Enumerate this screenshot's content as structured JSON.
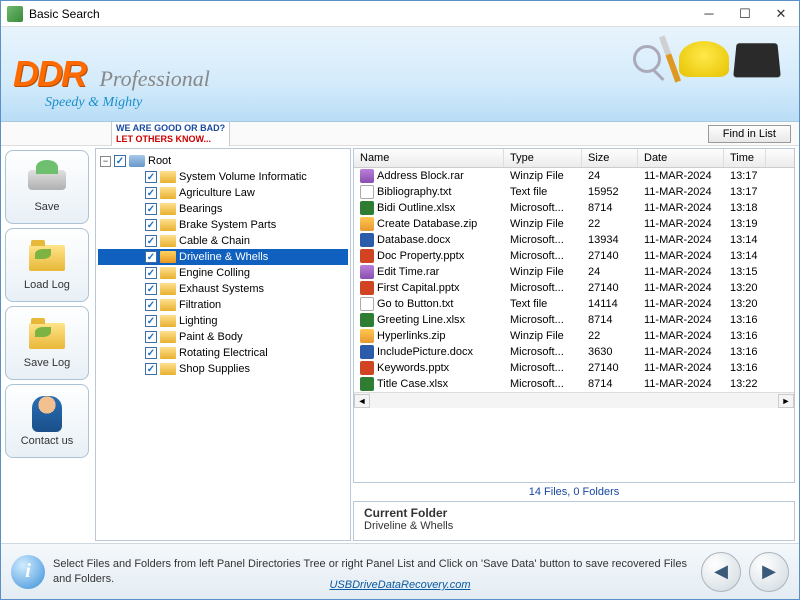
{
  "window": {
    "title": "Basic Search"
  },
  "banner": {
    "brand": "DDR",
    "product": "Professional",
    "tagline": "Speedy & Mighty"
  },
  "toolbar": {
    "good_bad_line1": "WE ARE GOOD OR BAD?",
    "good_bad_line2": "LET OTHERS KNOW...",
    "find_in_list": "Find in List"
  },
  "rail": {
    "save": "Save",
    "load_log": "Load Log",
    "save_log": "Save Log",
    "contact": "Contact us"
  },
  "tree": {
    "root": "Root",
    "items": [
      "System Volume Informatic",
      "Agriculture Law",
      "Bearings",
      "Brake System Parts",
      "Cable & Chain",
      "Driveline & Whells",
      "Engine Colling",
      "Exhaust Systems",
      "Filtration",
      "Lighting",
      "Paint & Body",
      "Rotating Electrical",
      "Shop Supplies"
    ],
    "selected_index": 5
  },
  "list": {
    "headers": {
      "name": "Name",
      "type": "Type",
      "size": "Size",
      "date": "Date",
      "time": "Time"
    },
    "rows": [
      {
        "icon": "rar",
        "name": "Address Block.rar",
        "type": "Winzip File",
        "size": "24",
        "date": "11-MAR-2024",
        "time": "13:17"
      },
      {
        "icon": "txt",
        "name": "Bibliography.txt",
        "type": "Text file",
        "size": "15952",
        "date": "11-MAR-2024",
        "time": "13:17"
      },
      {
        "icon": "xlsx",
        "name": "Bidi Outline.xlsx",
        "type": "Microsoft...",
        "size": "8714",
        "date": "11-MAR-2024",
        "time": "13:18"
      },
      {
        "icon": "zip",
        "name": "Create Database.zip",
        "type": "Winzip File",
        "size": "22",
        "date": "11-MAR-2024",
        "time": "13:19"
      },
      {
        "icon": "docx",
        "name": "Database.docx",
        "type": "Microsoft...",
        "size": "13934",
        "date": "11-MAR-2024",
        "time": "13:14"
      },
      {
        "icon": "pptx",
        "name": "Doc Property.pptx",
        "type": "Microsoft...",
        "size": "27140",
        "date": "11-MAR-2024",
        "time": "13:14"
      },
      {
        "icon": "rar",
        "name": "Edit Time.rar",
        "type": "Winzip File",
        "size": "24",
        "date": "11-MAR-2024",
        "time": "13:15"
      },
      {
        "icon": "pptx",
        "name": "First Capital.pptx",
        "type": "Microsoft...",
        "size": "27140",
        "date": "11-MAR-2024",
        "time": "13:20"
      },
      {
        "icon": "txt",
        "name": "Go to Button.txt",
        "type": "Text file",
        "size": "14114",
        "date": "11-MAR-2024",
        "time": "13:20"
      },
      {
        "icon": "xlsx",
        "name": "Greeting Line.xlsx",
        "type": "Microsoft...",
        "size": "8714",
        "date": "11-MAR-2024",
        "time": "13:16"
      },
      {
        "icon": "zip",
        "name": "Hyperlinks.zip",
        "type": "Winzip File",
        "size": "22",
        "date": "11-MAR-2024",
        "time": "13:16"
      },
      {
        "icon": "docx",
        "name": "IncludePicture.docx",
        "type": "Microsoft...",
        "size": "3630",
        "date": "11-MAR-2024",
        "time": "13:16"
      },
      {
        "icon": "pptx",
        "name": "Keywords.pptx",
        "type": "Microsoft...",
        "size": "27140",
        "date": "11-MAR-2024",
        "time": "13:16"
      },
      {
        "icon": "xlsx",
        "name": "Title Case.xlsx",
        "type": "Microsoft...",
        "size": "8714",
        "date": "11-MAR-2024",
        "time": "13:22"
      }
    ],
    "summary": "14 Files, 0 Folders"
  },
  "current_folder": {
    "label": "Current Folder",
    "value": "Driveline & Whells"
  },
  "footer": {
    "hint": "Select Files and Folders from left Panel Directories Tree or right Panel List and Click on 'Save Data' button to save recovered Files and Folders.",
    "url": "USBDriveDataRecovery.com"
  }
}
